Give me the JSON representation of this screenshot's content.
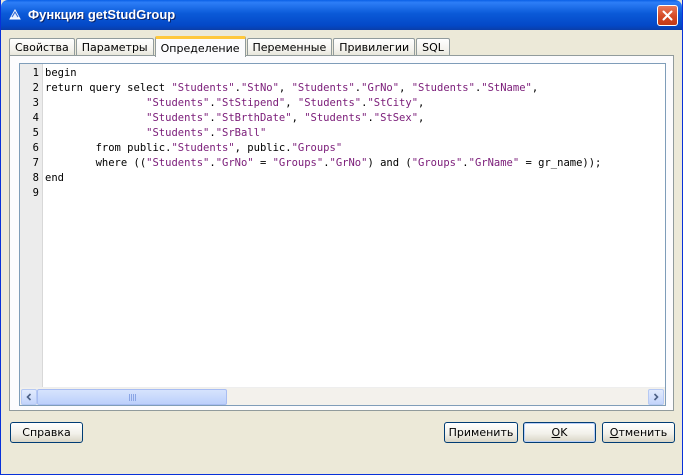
{
  "window": {
    "title": "Функция getStudGroup"
  },
  "tabs": [
    {
      "label": "Свойства",
      "active": false
    },
    {
      "label": "Параметры",
      "active": false
    },
    {
      "label": "Определение",
      "active": true
    },
    {
      "label": "Переменные",
      "active": false
    },
    {
      "label": "Привилегии",
      "active": false
    },
    {
      "label": "SQL",
      "active": false
    }
  ],
  "editor": {
    "line_numbers": [
      "1",
      "2",
      "3",
      "4",
      "5",
      "6",
      "7",
      "8",
      "9"
    ],
    "lines": [
      [
        {
          "t": "begin",
          "k": "p"
        }
      ],
      [
        {
          "t": "return query select ",
          "k": "p"
        },
        {
          "t": "\"Students\"",
          "k": "s"
        },
        {
          "t": ".",
          "k": "p"
        },
        {
          "t": "\"StNo\"",
          "k": "s"
        },
        {
          "t": ", ",
          "k": "p"
        },
        {
          "t": "\"Students\"",
          "k": "s"
        },
        {
          "t": ".",
          "k": "p"
        },
        {
          "t": "\"GrNo\"",
          "k": "s"
        },
        {
          "t": ", ",
          "k": "p"
        },
        {
          "t": "\"Students\"",
          "k": "s"
        },
        {
          "t": ".",
          "k": "p"
        },
        {
          "t": "\"StName\"",
          "k": "s"
        },
        {
          "t": ",",
          "k": "p"
        }
      ],
      [
        {
          "t": "                ",
          "k": "p"
        },
        {
          "t": "\"Students\"",
          "k": "s"
        },
        {
          "t": ".",
          "k": "p"
        },
        {
          "t": "\"StStipend\"",
          "k": "s"
        },
        {
          "t": ", ",
          "k": "p"
        },
        {
          "t": "\"Students\"",
          "k": "s"
        },
        {
          "t": ".",
          "k": "p"
        },
        {
          "t": "\"StCity\"",
          "k": "s"
        },
        {
          "t": ",",
          "k": "p"
        }
      ],
      [
        {
          "t": "                ",
          "k": "p"
        },
        {
          "t": "\"Students\"",
          "k": "s"
        },
        {
          "t": ".",
          "k": "p"
        },
        {
          "t": "\"StBrthDate\"",
          "k": "s"
        },
        {
          "t": ", ",
          "k": "p"
        },
        {
          "t": "\"Students\"",
          "k": "s"
        },
        {
          "t": ".",
          "k": "p"
        },
        {
          "t": "\"StSex\"",
          "k": "s"
        },
        {
          "t": ",",
          "k": "p"
        }
      ],
      [
        {
          "t": "                ",
          "k": "p"
        },
        {
          "t": "\"Students\"",
          "k": "s"
        },
        {
          "t": ".",
          "k": "p"
        },
        {
          "t": "\"SrBall\"",
          "k": "s"
        }
      ],
      [
        {
          "t": "        from public.",
          "k": "p"
        },
        {
          "t": "\"Students\"",
          "k": "s"
        },
        {
          "t": ", public.",
          "k": "p"
        },
        {
          "t": "\"Groups\"",
          "k": "s"
        }
      ],
      [
        {
          "t": "        where ((",
          "k": "p"
        },
        {
          "t": "\"Students\"",
          "k": "s"
        },
        {
          "t": ".",
          "k": "p"
        },
        {
          "t": "\"GrNo\"",
          "k": "s"
        },
        {
          "t": " = ",
          "k": "p"
        },
        {
          "t": "\"Groups\"",
          "k": "s"
        },
        {
          "t": ".",
          "k": "p"
        },
        {
          "t": "\"GrNo\"",
          "k": "s"
        },
        {
          "t": ") and (",
          "k": "p"
        },
        {
          "t": "\"Groups\"",
          "k": "s"
        },
        {
          "t": ".",
          "k": "p"
        },
        {
          "t": "\"GrName\"",
          "k": "s"
        },
        {
          "t": " = gr_name));",
          "k": "p"
        }
      ],
      [
        {
          "t": "end",
          "k": "p"
        }
      ],
      []
    ]
  },
  "buttons": {
    "help": "Справка",
    "apply": "Применить",
    "ok": "OK",
    "cancel": "Отменить"
  },
  "colors": {
    "title_gradient": "#0348c7",
    "string_literal": "#7a1b78",
    "active_tab_accent": "#ffc83c",
    "close_button": "#d44a25"
  }
}
